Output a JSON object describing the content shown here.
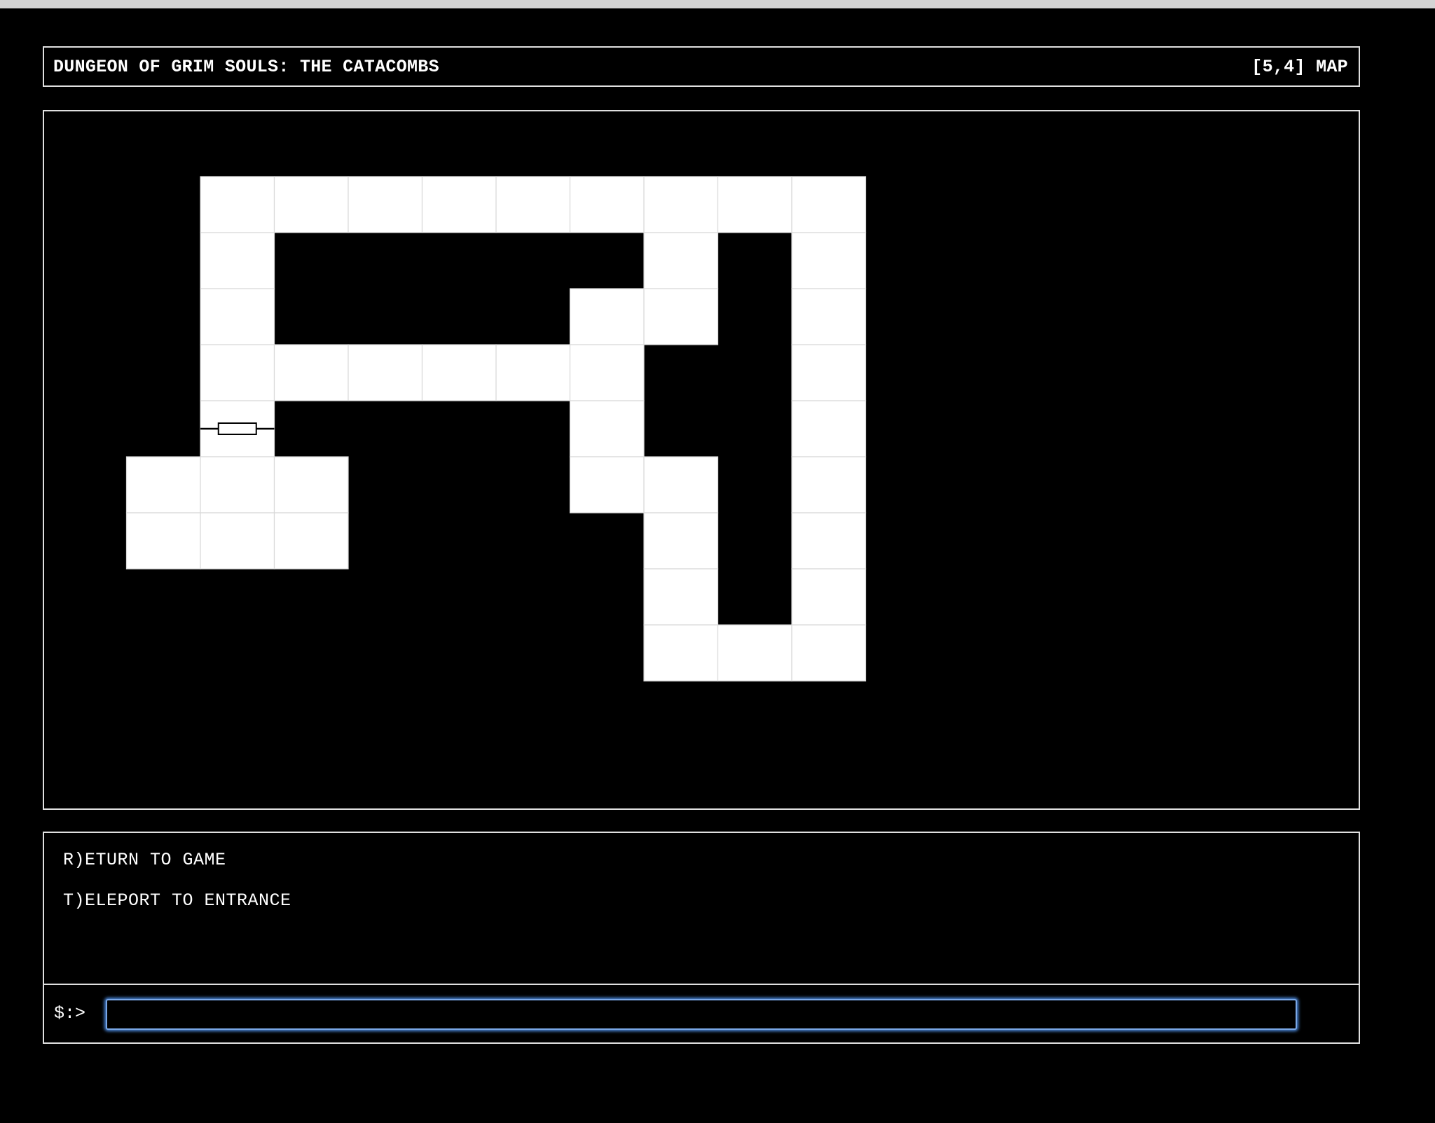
{
  "header": {
    "title": "DUNGEON OF GRIM SOULS: THE CATACOMBS",
    "status": "[5,4] MAP"
  },
  "map": {
    "grid_columns": 10,
    "grid_rows": 9,
    "explored_cells": [
      [
        2,
        0
      ],
      [
        3,
        0
      ],
      [
        4,
        0
      ],
      [
        5,
        0
      ],
      [
        6,
        0
      ],
      [
        7,
        0
      ],
      [
        8,
        0
      ],
      [
        9,
        0
      ],
      [
        10,
        0
      ],
      [
        2,
        1
      ],
      [
        8,
        1
      ],
      [
        10,
        1
      ],
      [
        2,
        2
      ],
      [
        7,
        2
      ],
      [
        8,
        2
      ],
      [
        10,
        2
      ],
      [
        2,
        3
      ],
      [
        3,
        3
      ],
      [
        4,
        3
      ],
      [
        5,
        3
      ],
      [
        6,
        3
      ],
      [
        7,
        3
      ],
      [
        10,
        3
      ],
      [
        2,
        4
      ],
      [
        7,
        4
      ],
      [
        10,
        4
      ],
      [
        1,
        5
      ],
      [
        2,
        5
      ],
      [
        3,
        5
      ],
      [
        7,
        5
      ],
      [
        8,
        5
      ],
      [
        10,
        5
      ],
      [
        1,
        6
      ],
      [
        2,
        6
      ],
      [
        3,
        6
      ],
      [
        8,
        6
      ],
      [
        10,
        6
      ],
      [
        8,
        7
      ],
      [
        10,
        7
      ],
      [
        8,
        8
      ],
      [
        9,
        8
      ],
      [
        10,
        8
      ]
    ],
    "door": {
      "col": 2,
      "row": 4,
      "icon": "door-icon"
    },
    "cell_color": "#ffffff",
    "grid_line_color": "#d9d9d9"
  },
  "menu": {
    "items": [
      {
        "label": "R)ETURN TO GAME"
      },
      {
        "label": "T)ELEPORT TO ENTRANCE"
      }
    ]
  },
  "prompt": {
    "label": "$:>",
    "value": ""
  },
  "colors": {
    "background": "#000000",
    "foreground": "#ffffff",
    "input_focus": "#4a86d8"
  }
}
